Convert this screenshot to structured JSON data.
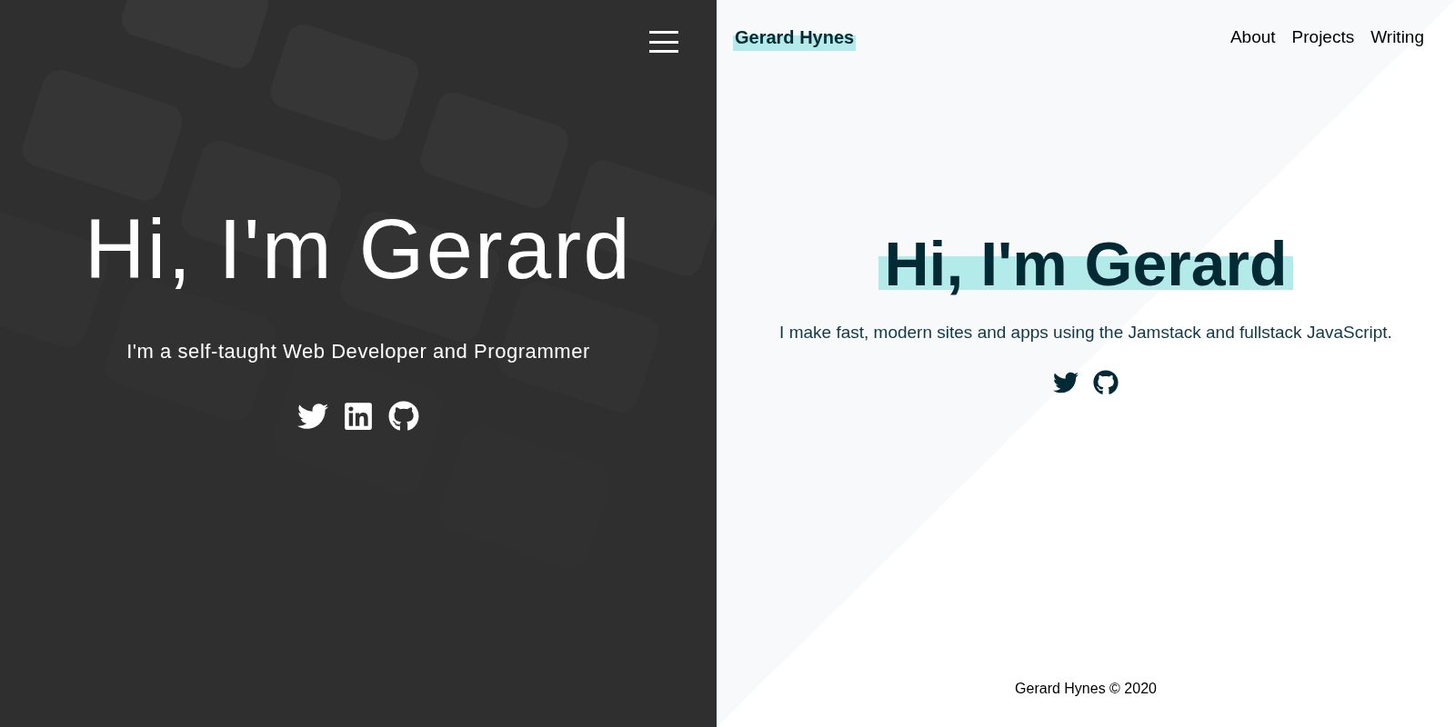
{
  "left": {
    "heading": "Hi, I'm Gerard",
    "tagline": "I'm a self-taught Web Developer and Programmer",
    "social": [
      {
        "kind": "twitter"
      },
      {
        "kind": "linkedin"
      },
      {
        "kind": "github"
      }
    ]
  },
  "right": {
    "brand": "Gerard Hynes",
    "nav": [
      "About",
      "Projects",
      "Writing"
    ],
    "heading": "Hi, I'm Gerard",
    "intro": "I make fast, modern sites and apps using the Jamstack and fullstack JavaScript.",
    "social": [
      {
        "kind": "twitter"
      },
      {
        "kind": "github"
      }
    ],
    "footer": "Gerard Hynes © 2020"
  }
}
